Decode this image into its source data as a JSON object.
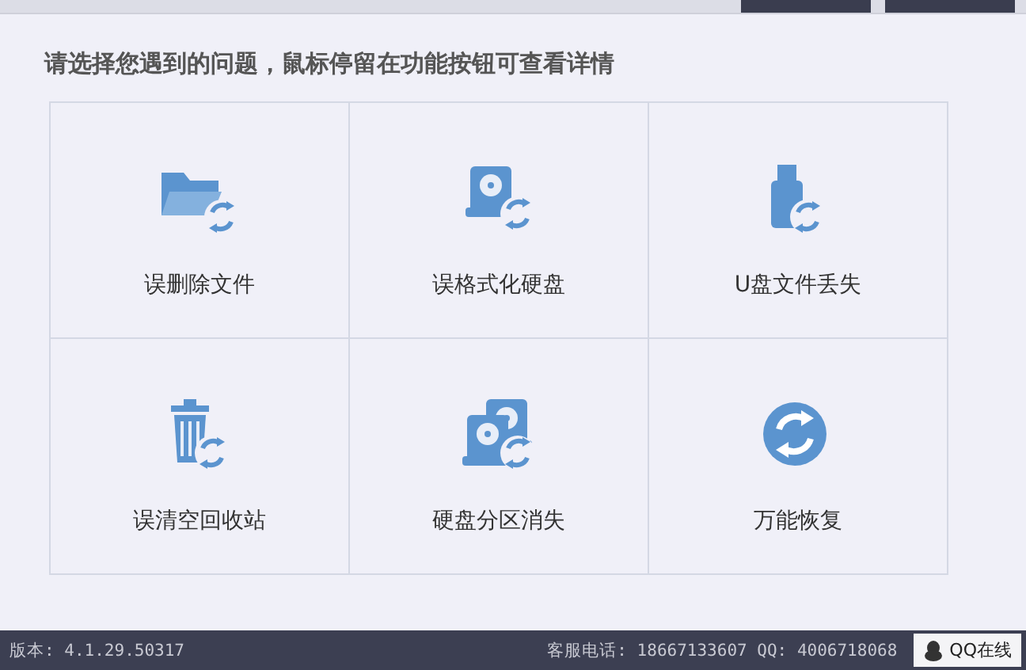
{
  "heading": "请选择您遇到的问题，鼠标停留在功能按钮可查看详情",
  "options": [
    {
      "kind": "folder",
      "label": "误删除文件"
    },
    {
      "kind": "disk",
      "label": "误格式化硬盘"
    },
    {
      "kind": "usb",
      "label": "U盘文件丢失"
    },
    {
      "kind": "trash",
      "label": "误清空回收站"
    },
    {
      "kind": "disks",
      "label": "硬盘分区消失"
    },
    {
      "kind": "refresh",
      "label": "万能恢复"
    }
  ],
  "status_bar": {
    "version": "版本: 4.1.29.50317",
    "contact": "客服电话: 18667133607 QQ: 4006718068",
    "qq_button": "QQ在线"
  }
}
